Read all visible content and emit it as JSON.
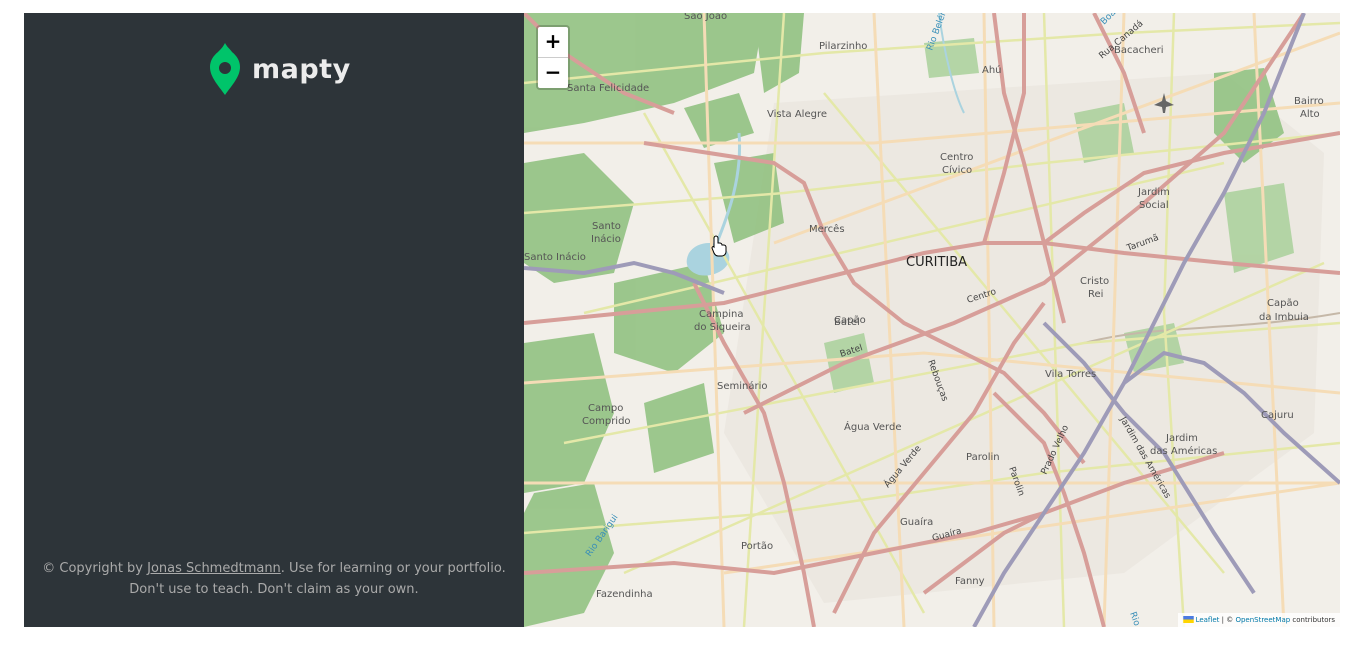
{
  "app": {
    "logo_text": "mapty",
    "copyright_prefix": "© Copyright by",
    "copyright_author": "Jonas Schmedtmann",
    "copyright_suffix": ". Use for learning or your portfolio. Don't use to teach. Don't claim as your own."
  },
  "map": {
    "zoom_in_label": "+",
    "zoom_out_label": "−",
    "attribution": {
      "leaflet": "Leaflet",
      "separator": " | © ",
      "osm": "OpenStreetMap",
      "suffix": " contributors"
    },
    "city_label": "CURITIBA",
    "place_labels": [
      "São João",
      "Pilarzinho",
      "Ahú",
      "Bacacheri",
      "Bairro",
      "Alto",
      "Santa Felicidade",
      "Vista Alegre",
      "Centro",
      "Cívico",
      "Jardim",
      "Social",
      "Santo",
      "Inácio",
      "Santo Inácio",
      "Mercês",
      "Cristo",
      "Rei",
      "Campina",
      "do Siqueira",
      "Bigorrilho",
      "Batel",
      "Capão",
      "da Imbuia",
      "Seminário",
      "Vila Torres",
      "Campo",
      "Comprido",
      "Água Verde",
      "Cajuru",
      "Jardim",
      "das Américas",
      "Parolin",
      "Guaíra",
      "Portão",
      "Fanny",
      "Fazendinha"
    ],
    "street_labels": [
      "Rua Canadá",
      "Tarumã",
      "Centro",
      "Batel",
      "Rebouças",
      "Água Verde",
      "Prado Velho",
      "Parolin",
      "Guaíra",
      "Jardim das Américas"
    ],
    "river_labels": [
      "Rio Belém",
      "Rio Barigui",
      "Rio",
      "Boa"
    ],
    "colors": {
      "land": "#f2efe9",
      "park": "#add19e",
      "forest": "#8dbf7c",
      "water": "#aad3df",
      "primary_road": "#d79e99",
      "secondary_road": "#f5dcb6",
      "tertiary_road": "#e4e8a8",
      "railway": "#9e9bb8"
    }
  }
}
